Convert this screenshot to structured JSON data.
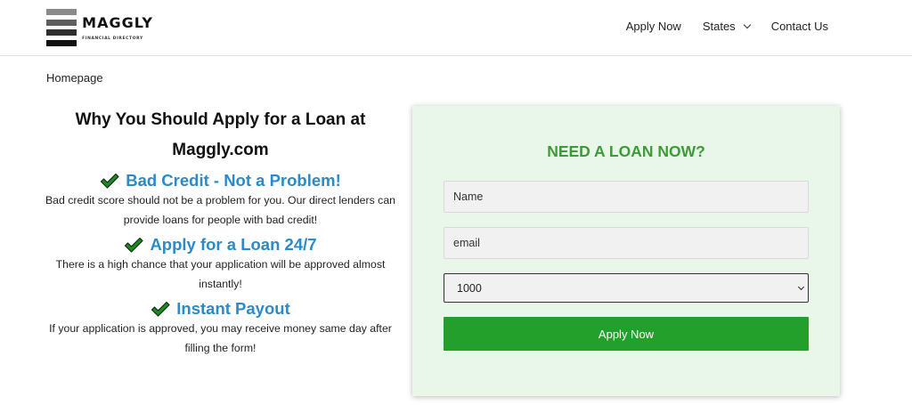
{
  "brand": {
    "name": "MAGGLY",
    "tagline": "FINANCIAL DIRECTORY"
  },
  "nav": {
    "apply_now": "Apply Now",
    "states": "States",
    "contact_us": "Contact Us"
  },
  "breadcrumb": "Homepage",
  "left": {
    "title_line1": "Why You Should Apply for a Loan at",
    "title_line2": "Maggly.com",
    "features": [
      {
        "title": "Bad Credit - Not a Problem!",
        "text_line1": "Bad credit score should not be a problem for you. Our direct lenders can",
        "text_line2": "provide loans for people with bad credit!"
      },
      {
        "title": "Apply for a Loan 24/7",
        "text_line1": "There is a high chance that your application will be approved almost",
        "text_line2": "instantly!"
      },
      {
        "title": "Instant Payout",
        "text_line1": "If your application is approved, you may receive money same day after",
        "text_line2": "filling the form!"
      }
    ]
  },
  "form": {
    "title": "NEED A LOAN NOW?",
    "name_placeholder": "Name",
    "email_placeholder": "email",
    "amount_selected": "1000",
    "submit_label": "Apply Now"
  },
  "colors": {
    "feature_title": "#2c8ac8",
    "panel_bg": "#e9f7e9",
    "panel_title": "#3c9a37",
    "submit_bg": "#23a02b",
    "check_fill": "#1e8a23"
  },
  "icons": {
    "check": "checkmark-icon",
    "states_dropdown": "chevron-down-icon",
    "amount_dropdown": "chevron-down-icon"
  }
}
